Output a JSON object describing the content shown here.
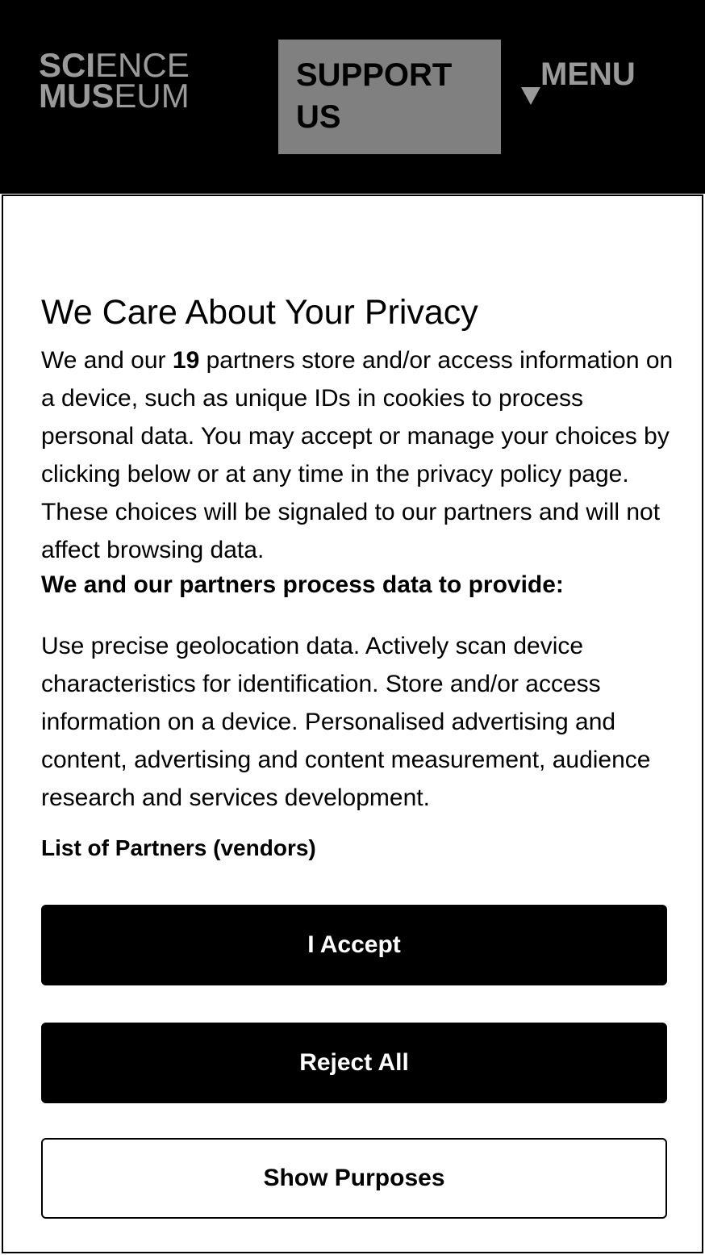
{
  "header": {
    "logo": {
      "line1_bold": "SCI",
      "line1_light": "ENCE",
      "line2_bold": "MUS",
      "line2_light": "EUM"
    },
    "support_label_line1": "SUPPORT",
    "support_label_line2": "US",
    "menu_label": "MENU",
    "menu_icon": "triangle-down-icon"
  },
  "consent": {
    "title": "We Care About Your Privacy",
    "intro_prefix": "We and our ",
    "partner_count": "19",
    "intro_suffix": " partners store and/or access information on a device, such as unique IDs in cookies to process personal data. You may accept or manage your choices by clicking below or at any time in the privacy policy page. These choices will be signaled to our partners and will not affect browsing data.",
    "purposes_heading": "We and our partners process data to provide:",
    "purposes_text": "Use precise geolocation data. Actively scan device characteristics for identification. Store and/or access information on a device. Personalised advertising and content, advertising and content measurement, audience research and services development.",
    "partners_link": "List of Partners (vendors)",
    "accept_label": "I Accept",
    "reject_label": "Reject All",
    "show_purposes_label": "Show Purposes"
  },
  "colors": {
    "header_bg": "#000000",
    "logo_gray": "#9a9a9a",
    "support_bg": "#808080",
    "primary_button": "#000000"
  }
}
